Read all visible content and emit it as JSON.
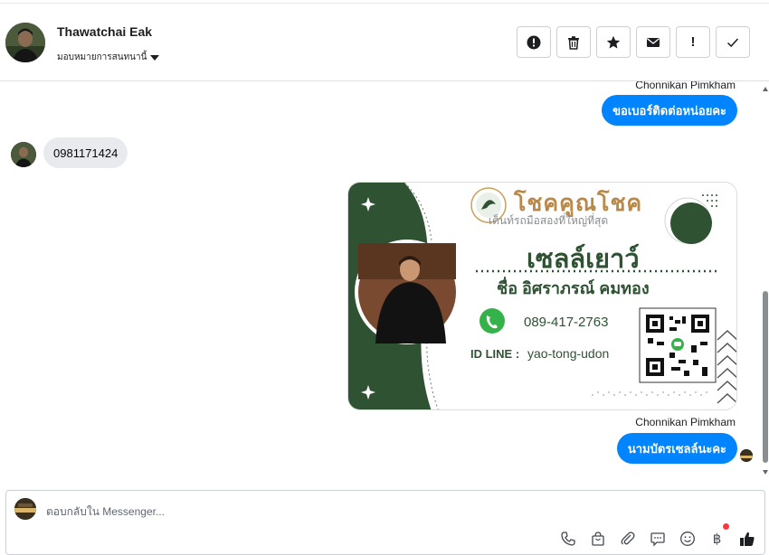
{
  "header": {
    "name": "Thawatchai Eak",
    "assign_label": "มอบหมายการสนทนานี้",
    "actions": [
      "mark-spam",
      "delete",
      "star",
      "mark-unread",
      "flag",
      "mark-done"
    ],
    "flag_symbol": "!"
  },
  "thread": {
    "messages": [
      {
        "sender": "Chonnikan Pimkham",
        "text": "ขอเบอร์ติดต่อหน่อยคะ",
        "direction": "outgoing"
      },
      {
        "text": "0981171424",
        "direction": "incoming"
      },
      {
        "sender": "Chonnikan Pimkham",
        "text": "นามบัตรเซลล์นะคะ",
        "direction": "outgoing"
      }
    ],
    "card": {
      "brand": "โชคคูณโชค",
      "tagline": "เต็นท์รถมือสองที่ใหญ่ที่สุด",
      "role": "เซลล์เยาว์",
      "person": "ชื่อ อิศราภรณ์  คมทอง",
      "phone": "089-417-2763",
      "line_label": "ID LINE :",
      "line_id": "yao-tong-udon",
      "brand_color": "#2f5233",
      "accent_color": "#c9a15a"
    }
  },
  "composer": {
    "placeholder": "ตอบกลับใน Messenger...",
    "tools": [
      "phone-icon",
      "shopping-bag-icon",
      "attachment-icon",
      "saved-reply-icon",
      "emoji-icon",
      "payment-icon",
      "like-icon"
    ],
    "payment_symbol": "฿"
  },
  "colors": {
    "outgoing_bubble": "#0084ff",
    "incoming_bubble": "#e9eaed",
    "notification_dot": "#fa383e"
  }
}
